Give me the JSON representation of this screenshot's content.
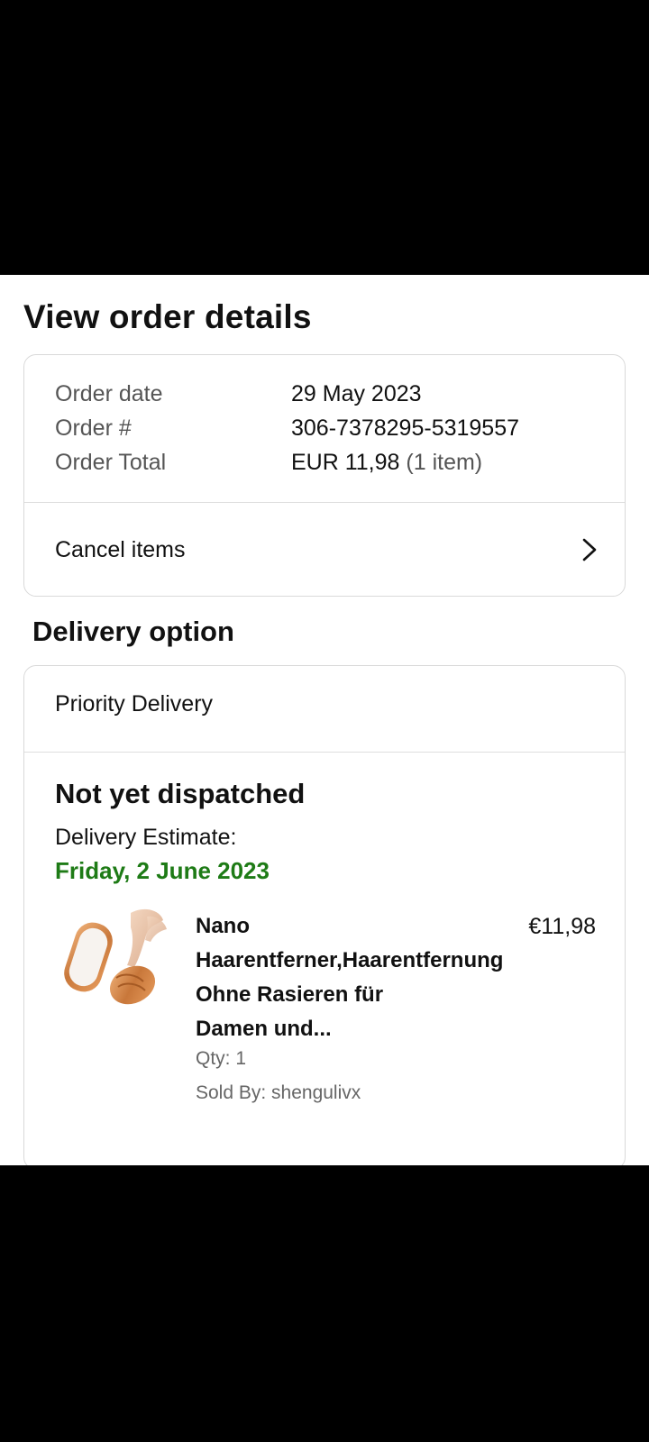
{
  "page": {
    "title": "View order details"
  },
  "order_summary": {
    "rows": [
      {
        "label": "Order date",
        "value": "29 May 2023"
      },
      {
        "label": "Order #",
        "value": "306-7378295-5319557"
      },
      {
        "label": "Order Total",
        "value": "EUR 11,98",
        "value_note": "(1 item)"
      }
    ],
    "cancel_label": "Cancel items"
  },
  "delivery": {
    "section_title": "Delivery option",
    "option_label": "Priority Delivery",
    "status": "Not yet dispatched",
    "estimate_label": "Delivery Estimate:",
    "estimate_date": "Friday, 2 June 2023",
    "estimate_color": "#1e7b16"
  },
  "item": {
    "title_lines": [
      "Nano",
      "Haarentferner,Haarentfernung",
      "Ohne Rasieren für",
      "Damen und..."
    ],
    "price": "€11,98",
    "qty": "Qty: 1",
    "seller": "Sold By: shengulivx",
    "image_icon": "crystal-hair-eraser-product-image"
  }
}
